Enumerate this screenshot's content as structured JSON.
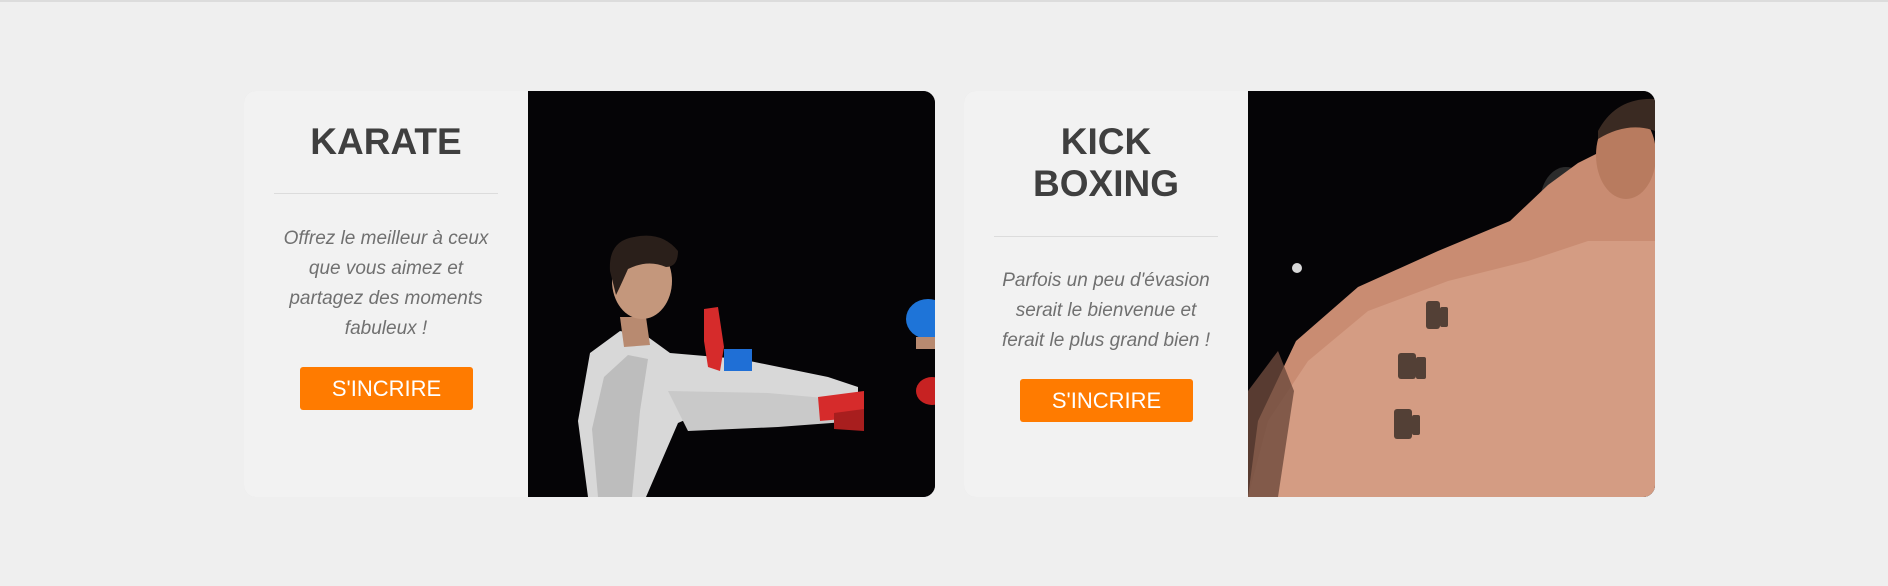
{
  "cards": [
    {
      "title": "KARATE",
      "description": "Offrez le meilleur à ceux que vous aimez et partagez des moments fabuleux !",
      "button_label": "S'INCRIRE",
      "image": "karate-photo"
    },
    {
      "title": "KICK\nBOXING",
      "description": "Parfois un peu d'évasion serait le bienvenue et ferait le plus grand bien !",
      "button_label": "S'INCRIRE",
      "image": "kickboxing-photo"
    }
  ],
  "colors": {
    "page_background": "#efefef",
    "card_background": "#f2f2f2",
    "title": "#3f3f3f",
    "description": "#707070",
    "button": "#ff7b00",
    "button_text": "#ffffff",
    "photo_background": "#050406"
  }
}
